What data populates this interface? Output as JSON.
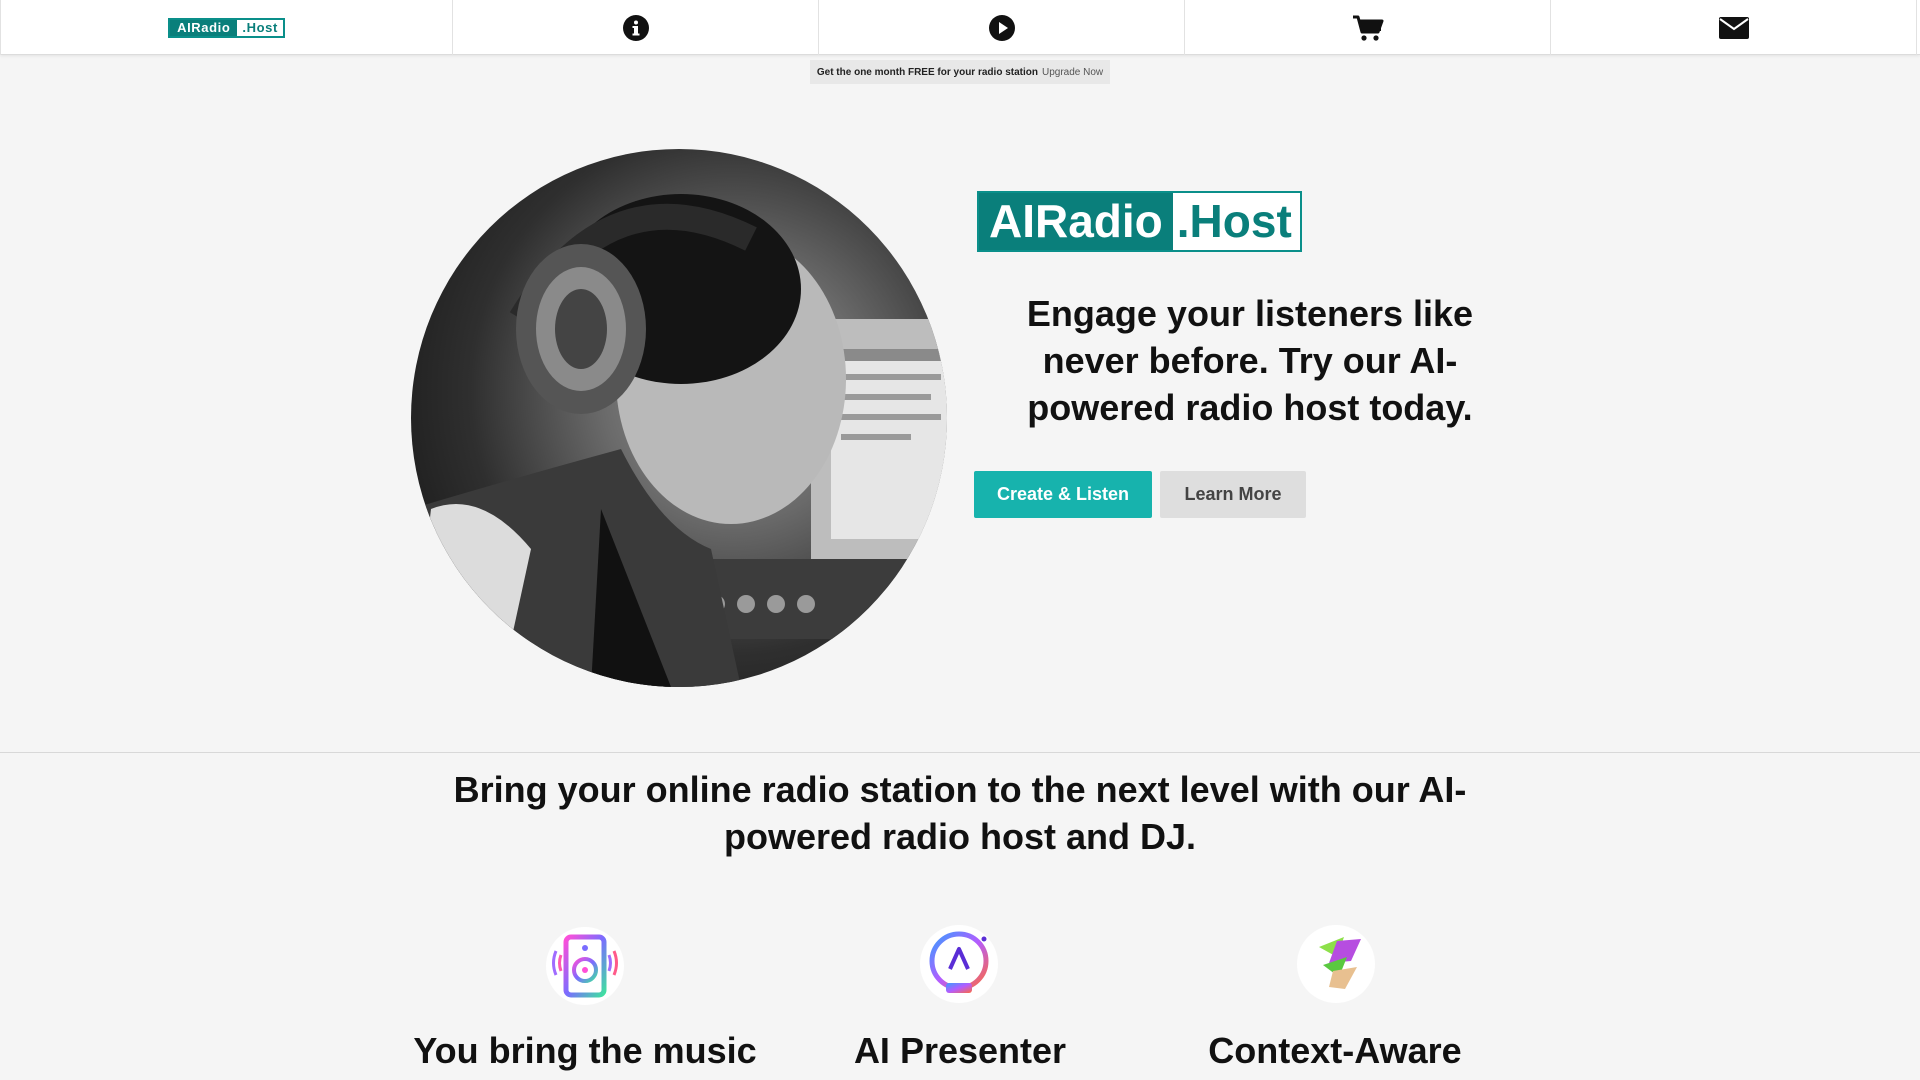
{
  "nav": {
    "logo": {
      "part1": "AIRadio",
      "part2": ".Host"
    },
    "icons": [
      "info-icon",
      "play-icon",
      "cart-icon",
      "envelope-icon"
    ]
  },
  "promo": {
    "text": "Get the one month FREE for your radio station",
    "link": "Upgrade Now"
  },
  "hero": {
    "logo": {
      "part1": "AIRadio",
      "part2": ".Host"
    },
    "tagline": "Engage your listeners like never before. Try our AI-powered radio host today.",
    "create_button": "Create & Listen",
    "learn_button": "Learn More"
  },
  "section": {
    "heading": "Bring your online radio station to the next level with our AI-powered radio host and DJ."
  },
  "features": [
    {
      "title": "You bring the music",
      "icon": "speaker-icon"
    },
    {
      "title": "AI Presenter",
      "icon": "ai-presenter-icon"
    },
    {
      "title": "Context-Aware",
      "icon": "context-aware-icon"
    }
  ],
  "colors": {
    "brand": "#0a7f7b",
    "button": "#17b3ad",
    "background": "#f5f5f5"
  }
}
